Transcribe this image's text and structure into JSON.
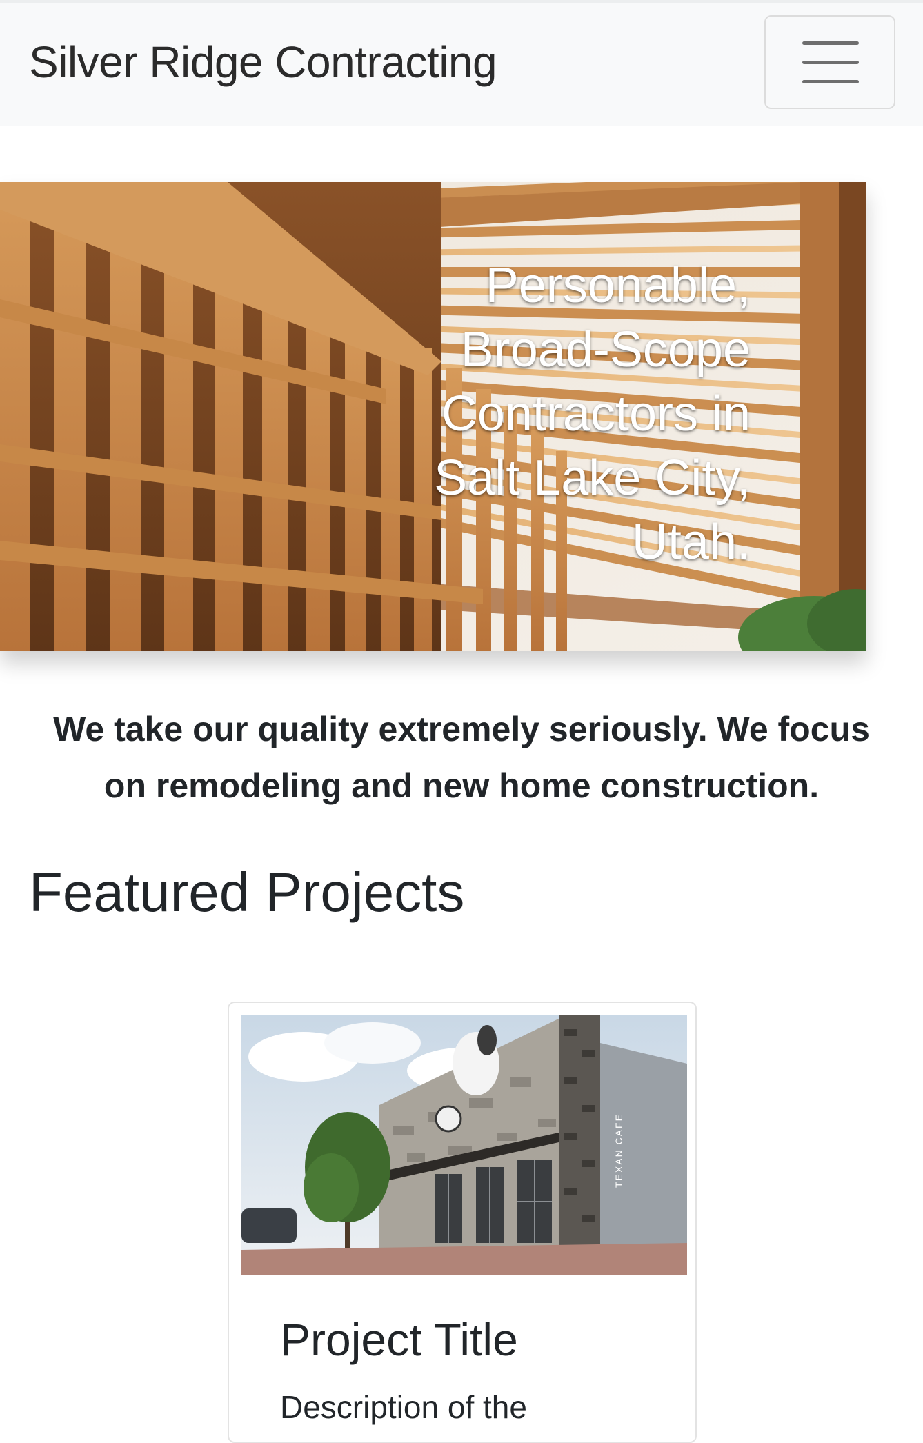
{
  "navbar": {
    "brand": "Silver Ridge Contracting",
    "toggle_icon": "hamburger-menu-icon"
  },
  "hero": {
    "image": "timber-framing-construction-photo",
    "headline_lines": [
      "Personable,",
      "Broad-Scope",
      "Contractors in",
      "Salt Lake City,",
      "Utah."
    ]
  },
  "tagline": "We take our quality extremely seriously. We focus on remodeling and new home construction.",
  "featured": {
    "heading": "Featured Projects",
    "cards": [
      {
        "image": "texan-cafe-storefront-photo",
        "image_sign": "TEXAN CAFE",
        "title": "Project Title",
        "text": "Description of the"
      }
    ]
  }
}
